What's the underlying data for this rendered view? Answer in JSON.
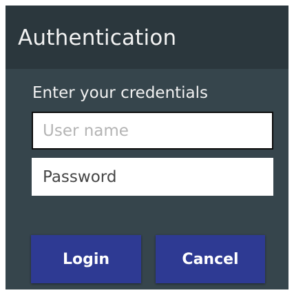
{
  "dialog": {
    "title": "Authentication",
    "prompt": "Enter your credentials",
    "username": {
      "placeholder": "User name",
      "value": ""
    },
    "password": {
      "placeholder": "Password",
      "value": ""
    },
    "buttons": {
      "login_label": "Login",
      "cancel_label": "Cancel"
    }
  },
  "colors": {
    "titlebar_bg": "#2b373d",
    "body_bg": "#36454c",
    "button_bg": "#2e3a93",
    "text_light": "#f2f2f2"
  }
}
